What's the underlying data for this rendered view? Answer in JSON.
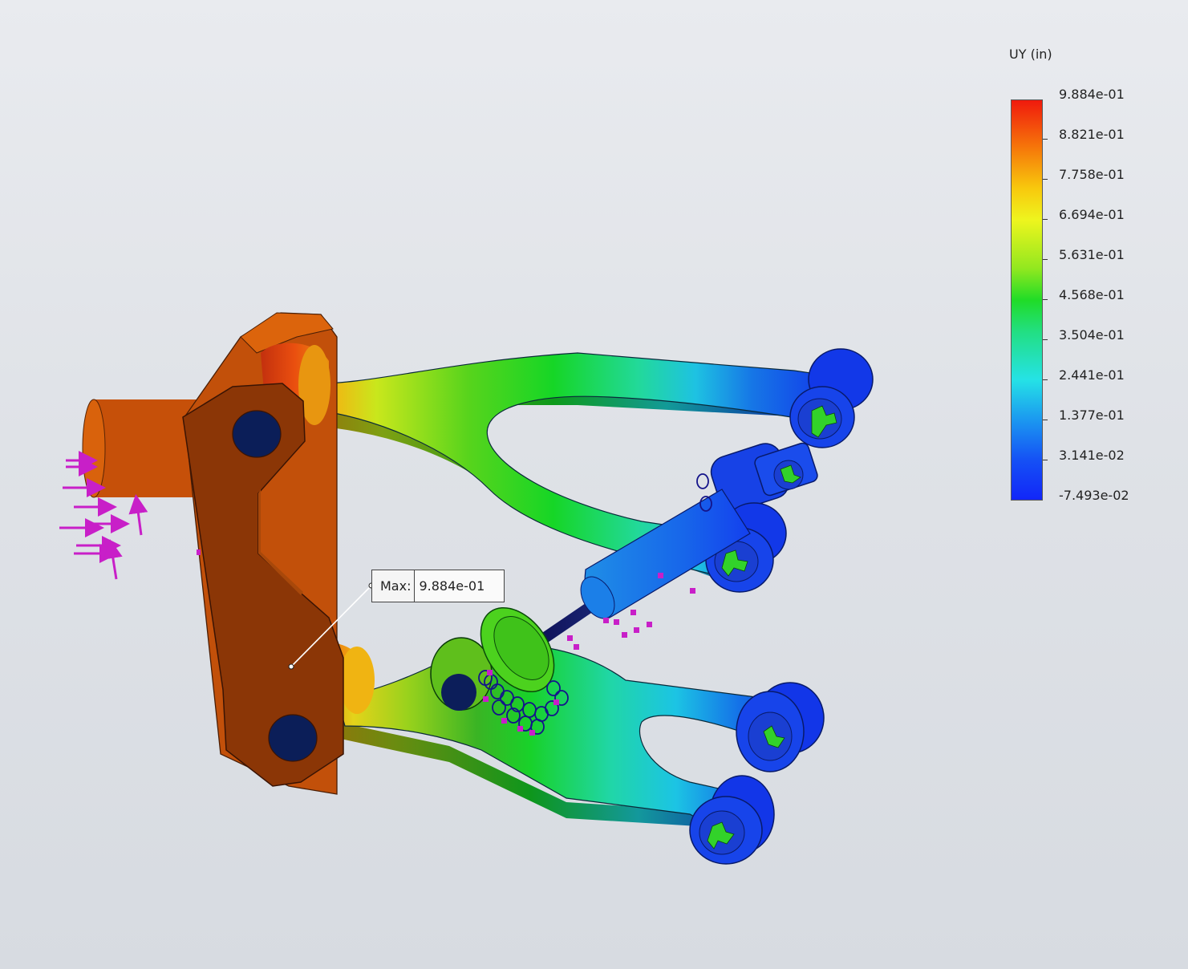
{
  "legend": {
    "title": "UY (in)",
    "labels": [
      "9.884e-01",
      "8.821e-01",
      "7.758e-01",
      "6.694e-01",
      "5.631e-01",
      "4.568e-01",
      "3.504e-01",
      "2.441e-01",
      "1.377e-01",
      "3.141e-02",
      "-7.493e-02"
    ]
  },
  "probe": {
    "label": "Max:",
    "value": "9.884e-01"
  },
  "colors": {
    "max": "#f01a0d",
    "min": "#1226f8",
    "load_arrows": "#c81fc8",
    "spring": "#14148a",
    "fixture": "#32d22a"
  }
}
